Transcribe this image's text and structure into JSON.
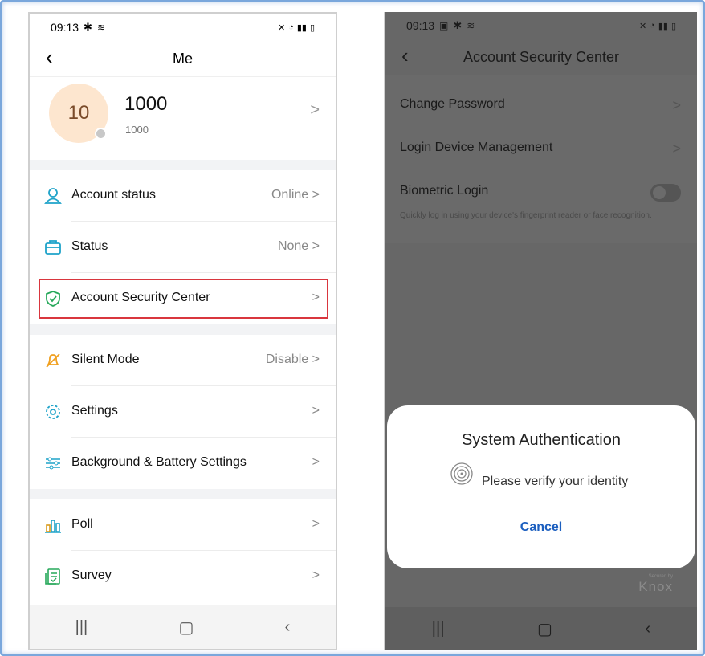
{
  "left": {
    "status_time": "09:13",
    "title": "Me",
    "profile": {
      "avatar_text": "10",
      "name": "1000",
      "id": "1000"
    },
    "rows": [
      {
        "label": "Account status",
        "value": "Online"
      },
      {
        "label": "Status",
        "value": "None"
      },
      {
        "label": "Account Security Center",
        "value": ""
      },
      {
        "label": "Silent Mode",
        "value": "Disable"
      },
      {
        "label": "Settings",
        "value": ""
      },
      {
        "label": "Background & Battery Settings",
        "value": ""
      },
      {
        "label": "Poll",
        "value": ""
      },
      {
        "label": "Survey",
        "value": ""
      }
    ]
  },
  "right": {
    "status_time": "09:13",
    "title": "Account Security Center",
    "items": [
      {
        "label": "Change Password"
      },
      {
        "label": "Login Device Management"
      },
      {
        "label": "Biometric Login"
      }
    ],
    "biometric_desc": "Quickly log in using your device's fingerprint reader or face recognition.",
    "dialog": {
      "title": "System Authentication",
      "message": "Please verify your identity",
      "cancel": "Cancel"
    },
    "knox": {
      "small": "Secured by",
      "brand": "Knox"
    }
  },
  "colors": {
    "accent_teal": "#1fa3c9",
    "highlight_red": "#d9363e",
    "dialog_cancel": "#1c5fbf",
    "avatar_bg": "#fde6cf"
  },
  "icons": [
    "settings-gear-icon",
    "user-icon",
    "briefcase-icon",
    "shield-check-icon",
    "bell-off-icon",
    "gear-icon",
    "sliders-icon",
    "bar-chart-icon",
    "survey-icon",
    "fingerprint-icon"
  ]
}
